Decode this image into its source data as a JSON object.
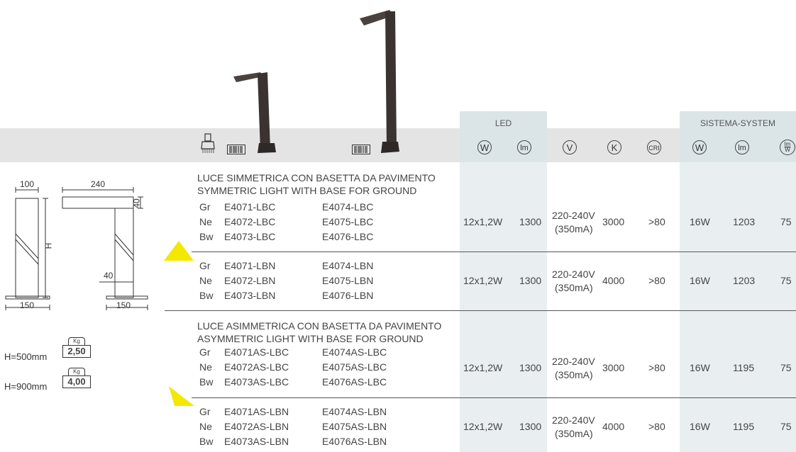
{
  "header": {
    "led_group": "LED",
    "system_group": "SISTEMA-SYSTEM",
    "symbols": {
      "led_w": "W",
      "led_lm": "lm",
      "v": "V",
      "k": "K",
      "cri": "CRI",
      "sys_w": "W",
      "sys_lm": "lm",
      "efficacy_num": "lm",
      "efficacy_den": "W"
    }
  },
  "groups": [
    {
      "title_it": "LUCE SIMMETRICA CON BASETTA DA PAVIMENTO",
      "title_en": "SYMMETRIC LIGHT WITH BASE FOR GROUND",
      "rows": [
        {
          "codes": [
            [
              "Gr",
              "E4071-LBC",
              "E4074-LBC"
            ],
            [
              "Ne",
              "E4072-LBC",
              "E4075-LBC"
            ],
            [
              "Bw",
              "E4073-LBC",
              "E4076-LBC"
            ]
          ],
          "led_w": "12x1,2W",
          "led_lm": "1300",
          "v": "220-240V",
          "ma": "(350mA)",
          "k": "3000",
          "cri": ">80",
          "sys_w": "16W",
          "sys_lm": "1203",
          "eff": "75"
        },
        {
          "codes": [
            [
              "Gr",
              "E4071-LBN",
              "E4074-LBN"
            ],
            [
              "Ne",
              "E4072-LBN",
              "E4075-LBN"
            ],
            [
              "Bw",
              "E4073-LBN",
              "E4076-LBN"
            ]
          ],
          "led_w": "12x1,2W",
          "led_lm": "1300",
          "v": "220-240V",
          "ma": "(350mA)",
          "k": "4000",
          "cri": ">80",
          "sys_w": "16W",
          "sys_lm": "1203",
          "eff": "75"
        }
      ]
    },
    {
      "title_it": "LUCE ASIMMETRICA CON BASETTA DA PAVIMENTO",
      "title_en": "ASYMMETRIC LIGHT WITH BASE FOR GROUND",
      "rows": [
        {
          "codes": [
            [
              "Gr",
              "E4071AS-LBC",
              "E4074AS-LBC"
            ],
            [
              "Ne",
              "E4072AS-LBC",
              "E4075AS-LBC"
            ],
            [
              "Bw",
              "E4073AS-LBC",
              "E4076AS-LBC"
            ]
          ],
          "led_w": "12x1,2W",
          "led_lm": "1300",
          "v": "220-240V",
          "ma": "(350mA)",
          "k": "3000",
          "cri": ">80",
          "sys_w": "16W",
          "sys_lm": "1195",
          "eff": "75"
        },
        {
          "codes": [
            [
              "Gr",
              "E4071AS-LBN",
              "E4074AS-LBN"
            ],
            [
              "Ne",
              "E4072AS-LBN",
              "E4075AS-LBN"
            ],
            [
              "Bw",
              "E4073AS-LBN",
              "E4076AS-LBN"
            ]
          ],
          "led_w": "12x1,2W",
          "led_lm": "1300",
          "v": "220-240V",
          "ma": "(350mA)",
          "k": "4000",
          "cri": ">80",
          "sys_w": "16W",
          "sys_lm": "1195",
          "eff": "75"
        }
      ]
    }
  ],
  "drawing": {
    "dim_100": "100",
    "dim_240": "240",
    "dim_40_top": "40",
    "dim_h": "H",
    "dim_40_side": "40",
    "dim_150_left": "150",
    "dim_150_right": "150"
  },
  "weights": [
    {
      "label": "H=500mm",
      "unit": "Kg",
      "value": "2,50"
    },
    {
      "label": "H=900mm",
      "unit": "Kg",
      "value": "4,00"
    }
  ],
  "colors": {
    "band": "#e9eff1",
    "header_bar": "#e4e4e4",
    "accent_yellow": "#f5e800",
    "lamp": "#3a3330"
  }
}
